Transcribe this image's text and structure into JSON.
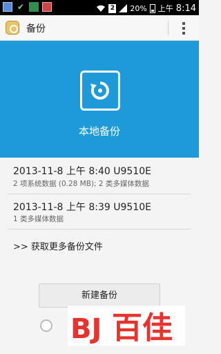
{
  "status_bar": {
    "battery_percent": "20%",
    "period": "上午",
    "time": "8:14",
    "sim_label": "2"
  },
  "action_bar": {
    "title": "备份"
  },
  "hero": {
    "label": "本地备份",
    "color": "#1e9ad9"
  },
  "backups": [
    {
      "title": "2013-11-8 上午 8:40 U9510E",
      "detail": "2 项系统数据 (0.28 MB); 2 类多媒体数据"
    },
    {
      "title": "2013-11-8 上午 8:39 U9510E",
      "detail": "1 类多媒体数据"
    }
  ],
  "more_link": ">> 获取更多备份文件",
  "new_backup_button": "新建备份",
  "watermark": {
    "text": "百佳",
    "logo_text": "BJ",
    "color": "#e8322e"
  }
}
